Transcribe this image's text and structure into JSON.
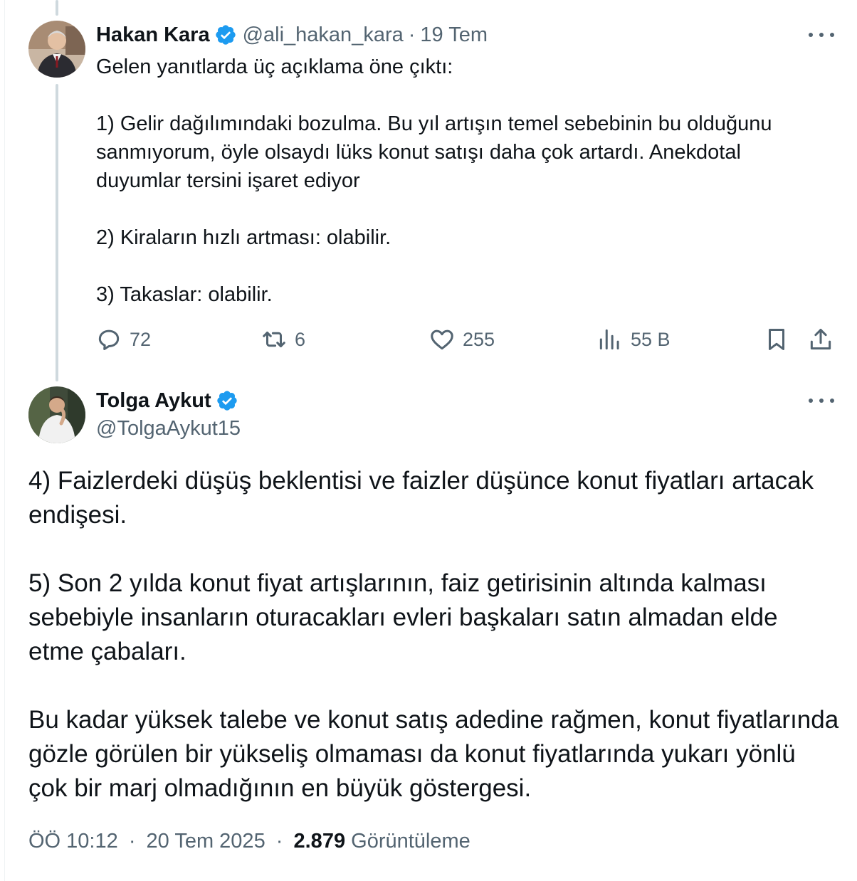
{
  "thread": {
    "parent": {
      "author_name": "Hakan Kara",
      "handle": "@ali_hakan_kara",
      "separator": "·",
      "date": "19 Tem",
      "paragraphs": [
        "Gelen yanıtlarda üç açıklama öne çıktı:",
        "1) Gelir dağılımındaki bozulma. Bu yıl artışın temel sebebinin bu olduğunu sanmıyorum, öyle olsaydı lüks konut satışı daha çok artardı. Anekdotal duyumlar tersini işaret ediyor",
        "2) Kiraların hızlı artması: olabilir.",
        "3) Takaslar: olabilir."
      ],
      "stats": {
        "replies": "72",
        "reposts": "6",
        "likes": "255",
        "views": "55 B"
      },
      "icons": [
        "verified-badge-icon",
        "more-icon",
        "reply-icon",
        "repost-icon",
        "like-icon",
        "views-icon",
        "bookmark-icon",
        "share-icon"
      ]
    },
    "reply": {
      "author_name": "Tolga Aykut",
      "handle": "@TolgaAykut15",
      "paragraphs": [
        "4) Faizlerdeki düşüş beklentisi ve faizler düşünce konut fiyatları artacak endişesi.",
        "5) Son 2 yılda konut fiyat artışlarının, faiz getirisinin altında kalması sebebiyle insanların oturacakları evleri başkaları satın almadan elde etme çabaları.",
        "Bu kadar yüksek talebe ve konut satış adedine rağmen, konut fiyatlarında gözle görülen bir yükseliş olmaması da konut fiyatlarında yukarı yönlü çok bir marj olmadığının en büyük göstergesi."
      ],
      "time": "ÖÖ 10:12",
      "separator": "·",
      "date": "20 Tem 2025",
      "views_count": "2.879",
      "views_label": "Görüntüleme"
    }
  },
  "colors": {
    "text": "#0f1419",
    "muted": "#536471",
    "verified": "#1d9bf0",
    "thread_line": "#cfd9de"
  }
}
